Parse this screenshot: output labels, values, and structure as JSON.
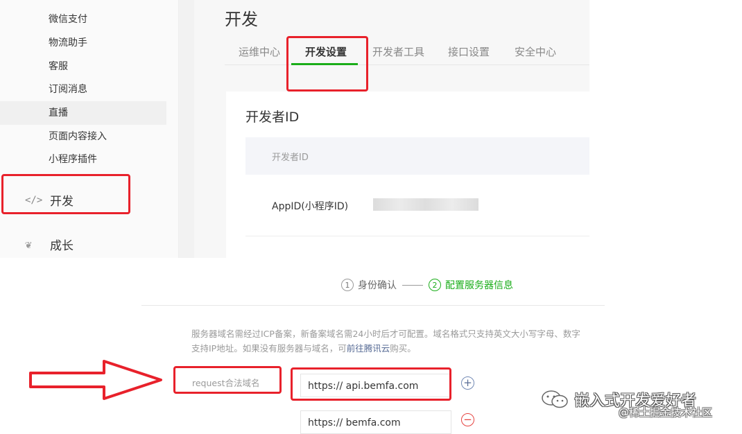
{
  "sidebar": {
    "items": [
      "微信支付",
      "物流助手",
      "客服",
      "订阅消息",
      "直播",
      "页面内容接入",
      "小程序插件"
    ],
    "sections": [
      {
        "icon": "code-icon",
        "glyph": "</>",
        "label": "开发"
      },
      {
        "icon": "sprout-icon",
        "glyph": "❦",
        "label": "成长"
      }
    ]
  },
  "main": {
    "title": "开发",
    "tabs": [
      "运维中心",
      "开发设置",
      "开发者工具",
      "接口设置",
      "安全中心"
    ],
    "active_tab": "开发设置",
    "card": {
      "title": "开发者ID",
      "header": "开发者ID",
      "row_label": "AppID(小程序ID)"
    }
  },
  "steps": {
    "step1_num": "1",
    "step1": "身份确认",
    "step2_num": "2",
    "step2": "配置服务器信息"
  },
  "server": {
    "note_line1": "服务器域名需经过ICP备案，新备案域名需24小时后才可配置。域名格式只支持英文大小写字母、数字",
    "note_line2_prefix": "支持IP地址。如果没有服务器与域名，可",
    "note_link": "前往腾讯云",
    "note_line2_suffix": "购买。",
    "request_label": "request合法域名",
    "domains": [
      "https:// api.bemfa.com",
      "https:// bemfa.com"
    ]
  },
  "watermark": {
    "title": "嵌入式开发爱好者",
    "subtitle": "@稀土掘金技术社区"
  },
  "colors": {
    "accent_green": "#1aad19",
    "annotation_red": "#e8212b",
    "link_blue": "#576b95"
  }
}
